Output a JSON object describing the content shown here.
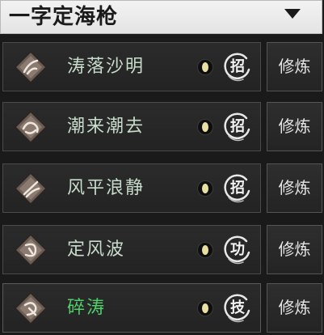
{
  "header": {
    "title": "一字定海枪",
    "dropdown_icon": "triangle-down-icon"
  },
  "skills": [
    {
      "name": "涛落沙明",
      "badge": "招",
      "train_label": "修炼",
      "highlighted": false
    },
    {
      "name": "潮来潮去",
      "badge": "招",
      "train_label": "修炼",
      "highlighted": false
    },
    {
      "name": "风平浪静",
      "badge": "招",
      "train_label": "修炼",
      "highlighted": false
    },
    {
      "name": "定风波",
      "badge": "功",
      "train_label": "修炼",
      "highlighted": false
    },
    {
      "name": "碎涛",
      "badge": "技",
      "train_label": "修炼",
      "highlighted": true
    }
  ],
  "colors": {
    "name_normal": "#c8dccb",
    "name_highlight": "#4fcf6a",
    "dot_fill": "#e8e0a0"
  }
}
